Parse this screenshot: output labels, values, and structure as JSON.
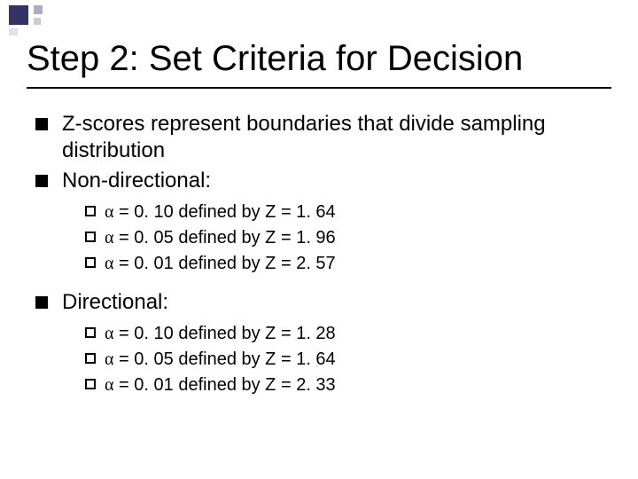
{
  "title": "Step 2: Set Criteria for Decision",
  "bullets": [
    {
      "text": "Z-scores represent boundaries that divide sampling distribution"
    },
    {
      "text": "Non-directional:",
      "sub": [
        {
          "alpha_eq": "= 0. 10",
          "defined": "defined by Z = 1. 64"
        },
        {
          "alpha_eq": "= 0. 05",
          "defined": "defined by Z = 1. 96"
        },
        {
          "alpha_eq": "= 0. 01",
          "defined": "defined by Z = 2. 57"
        }
      ]
    },
    {
      "text": "Directional:",
      "sub": [
        {
          "alpha_eq": "= 0. 10",
          "defined": "defined by Z = 1. 28"
        },
        {
          "alpha_eq": "= 0. 05",
          "defined": "defined by Z = 1. 64"
        },
        {
          "alpha_eq": "= 0. 01",
          "defined": "defined by Z = 2. 33"
        }
      ]
    }
  ],
  "alpha_glyph": "α"
}
